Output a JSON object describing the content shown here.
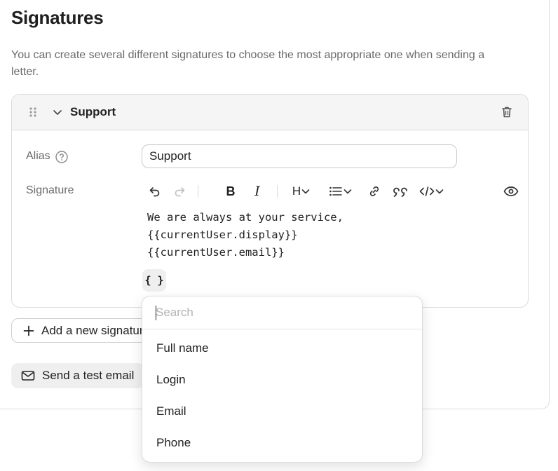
{
  "page": {
    "title": "Signatures",
    "description": "You can create several different signatures to choose the most appropriate one when sending a letter."
  },
  "signature_card": {
    "name": "Support",
    "alias_label": "Alias",
    "alias_value": "Support",
    "signature_label": "Signature",
    "body_lines": [
      "We are always at your service,",
      "{{currentUser.display}}",
      "{{currentUser.email}}"
    ],
    "variable_button": "{ }",
    "toolbar": {
      "undo_icon": "undo-icon",
      "redo_icon": "redo-icon",
      "bold_label": "B",
      "italic_label": "I",
      "heading_label": "H",
      "list_icon": "list-icon",
      "link_icon": "link-icon",
      "quote_icon": "quote-icon",
      "code_icon": "code-icon",
      "preview_icon": "eye-icon"
    }
  },
  "actions": {
    "add_signature": "Add a new signature",
    "send_test": "Send a test email"
  },
  "variable_dropdown": {
    "search_placeholder": "Search",
    "items": [
      "Full name",
      "Login",
      "Email",
      "Phone"
    ]
  }
}
